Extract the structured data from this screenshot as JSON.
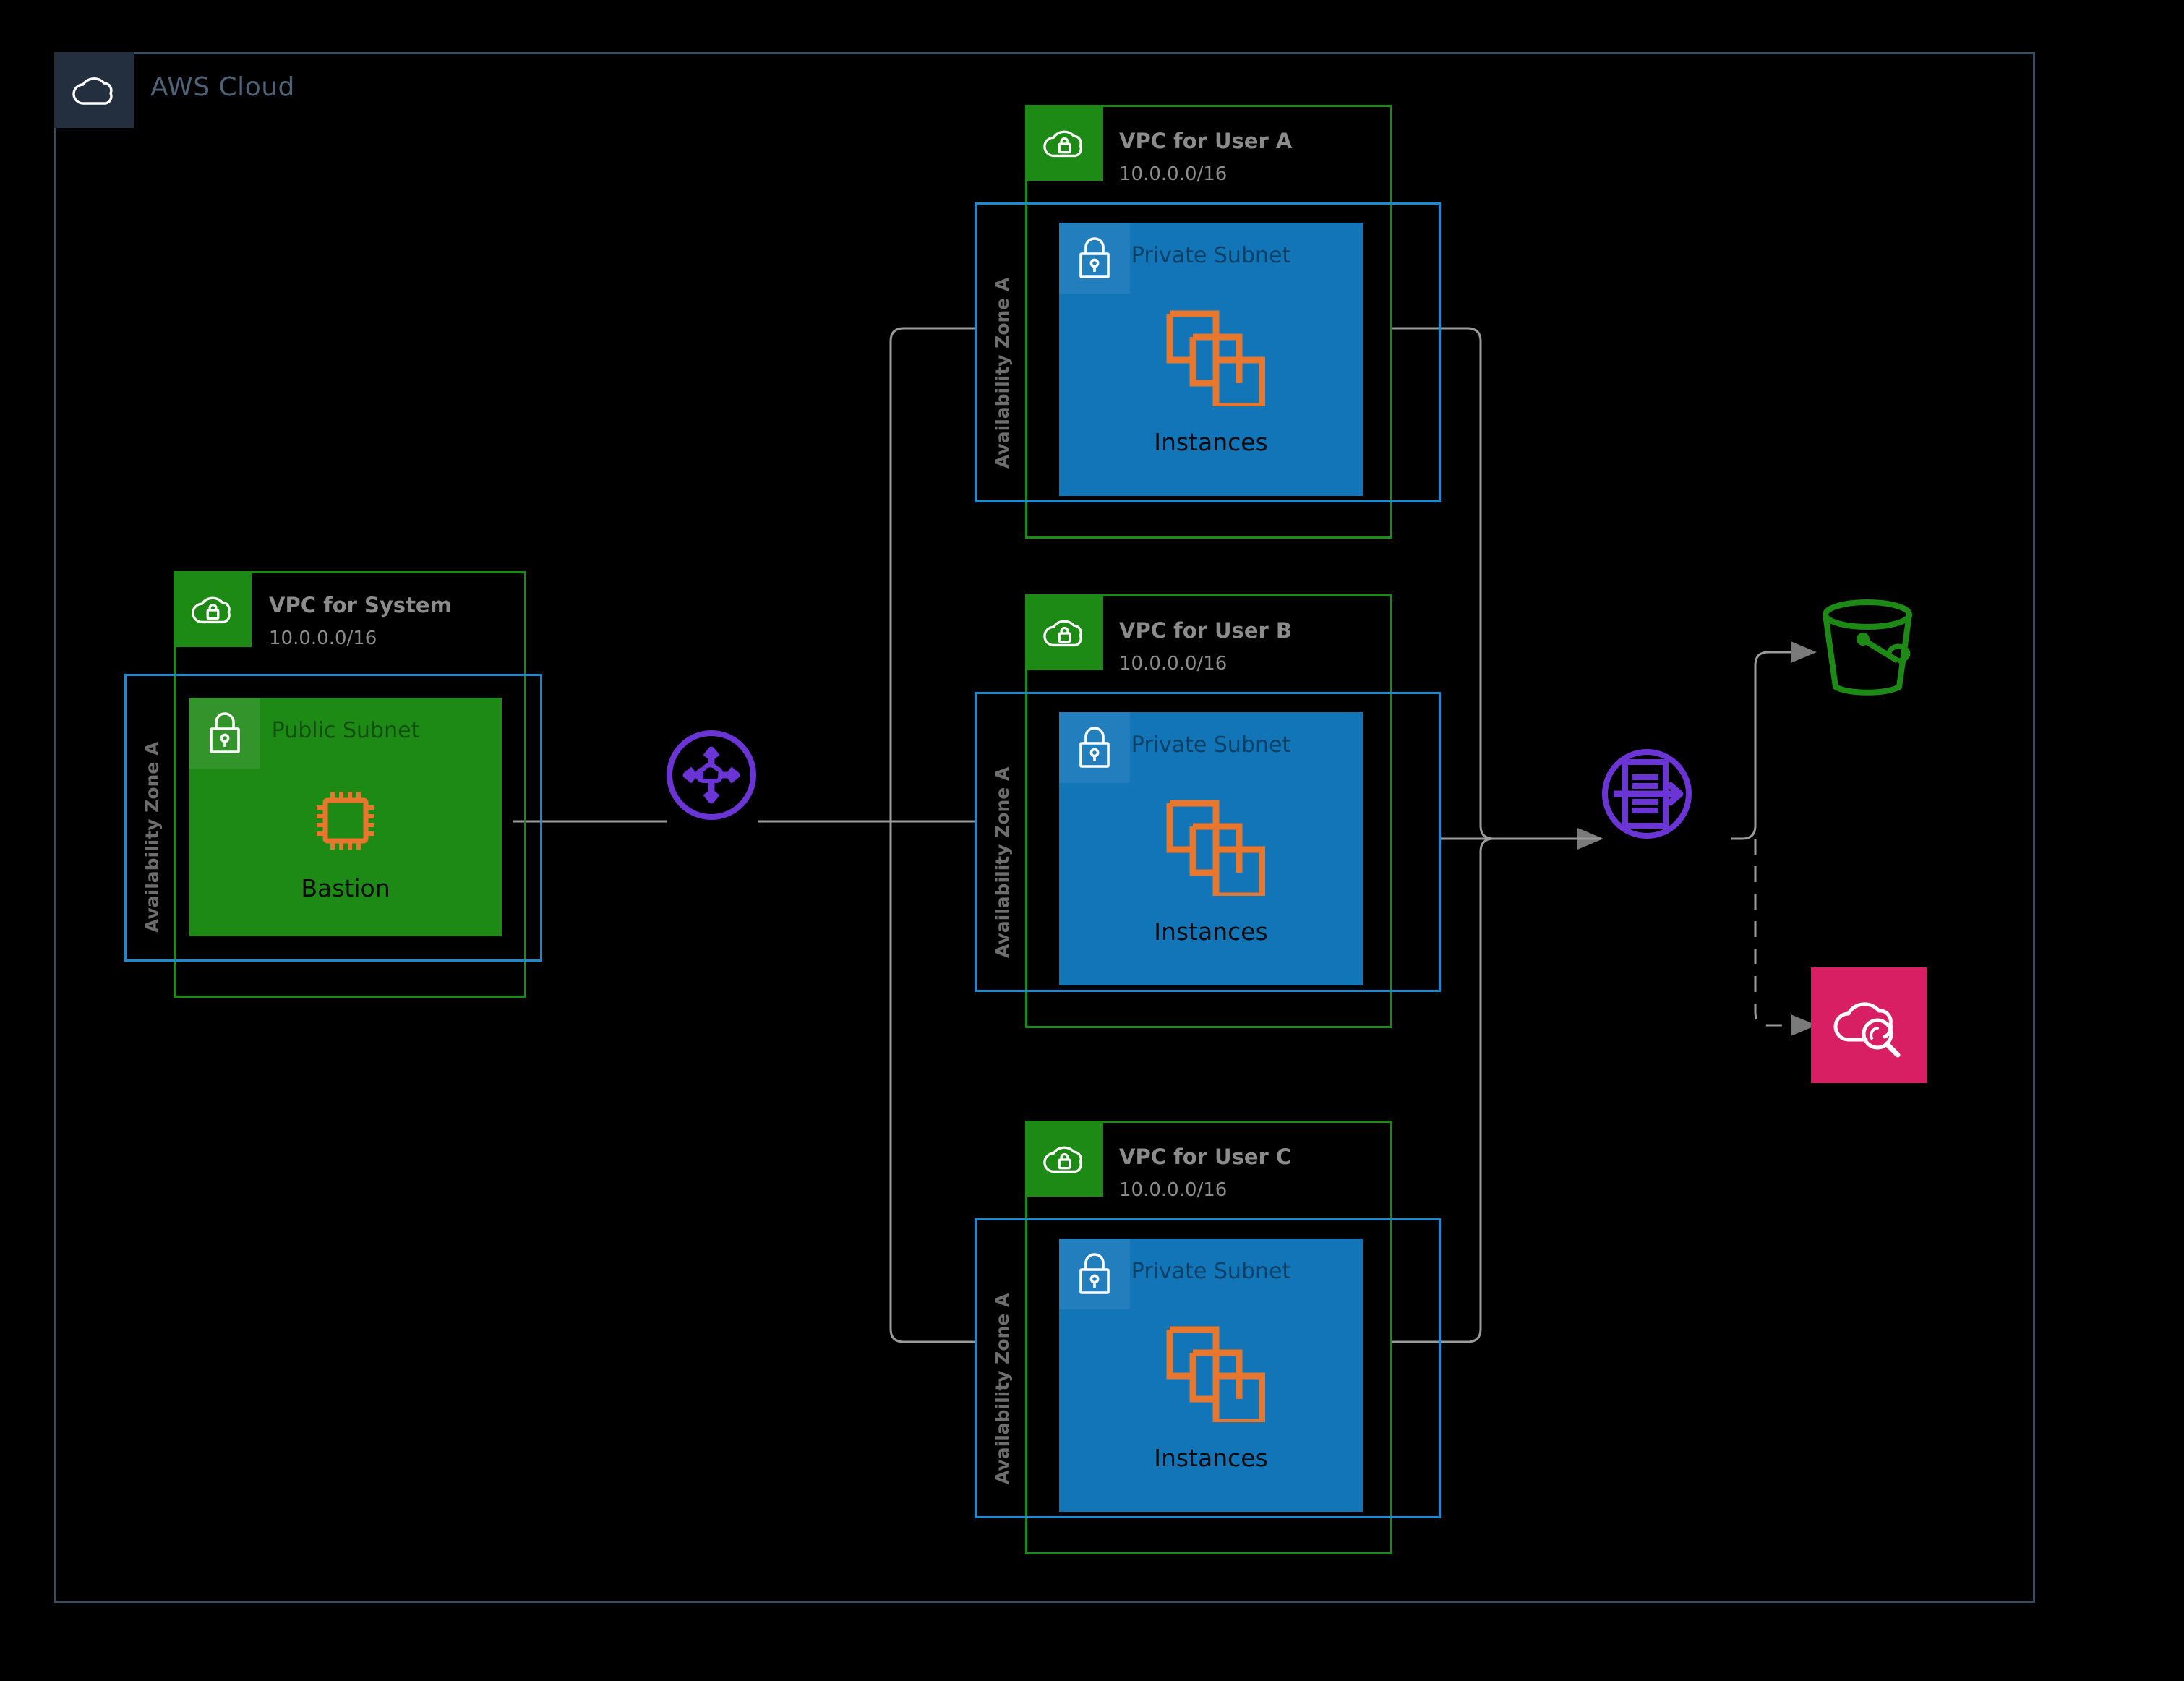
{
  "diagram": {
    "cloud": {
      "label": "AWS Cloud",
      "icon": "aws-cloud-icon",
      "frame_color": "#3B4C5E",
      "badge_color": "#232F3E",
      "label_color": "#4E6377"
    },
    "colors": {
      "vpc_green": "#1E8A16",
      "az_blue": "#1B8BD0",
      "private_subnet_blue": "#1275B8",
      "public_subnet_green": "#1E8A16",
      "instance_orange": "#E8762C",
      "transit_purple": "#6B34D4",
      "s3_green": "#1E8A16",
      "cloudwatch_pink": "#D81F64",
      "connector_gray": "#9B9B9B",
      "text_gray": "#8C8C8C"
    },
    "vpcs": [
      {
        "id": "vpc-system",
        "title": "VPC for System",
        "cidr": "10.0.0.0/16",
        "icon": "vpc-cloud-lock-icon",
        "az": {
          "label": "Availability Zone A"
        },
        "subnet": {
          "type": "public",
          "title": "Public Subnet",
          "icon": "subnet-lock-icon",
          "resource": {
            "label": "Bastion",
            "icon": "ec2-chip-icon"
          }
        }
      },
      {
        "id": "vpc-user-a",
        "title": "VPC for User A",
        "cidr": "10.0.0.0/16",
        "icon": "vpc-cloud-lock-icon",
        "az": {
          "label": "Availability Zone A"
        },
        "subnet": {
          "type": "private",
          "title": "Private Subnet",
          "icon": "subnet-lock-icon",
          "resource": {
            "label": "Instances",
            "icon": "instances-icon"
          }
        }
      },
      {
        "id": "vpc-user-b",
        "title": "VPC for User B",
        "cidr": "10.0.0.0/16",
        "icon": "vpc-cloud-lock-icon",
        "az": {
          "label": "Availability Zone A"
        },
        "subnet": {
          "type": "private",
          "title": "Private Subnet",
          "icon": "subnet-lock-icon",
          "resource": {
            "label": "Instances",
            "icon": "instances-icon"
          }
        }
      },
      {
        "id": "vpc-user-c",
        "title": "VPC for User C",
        "cidr": "10.0.0.0/16",
        "icon": "vpc-cloud-lock-icon",
        "az": {
          "label": "Availability Zone A"
        },
        "subnet": {
          "type": "private",
          "title": "Private Subnet",
          "icon": "subnet-lock-icon",
          "resource": {
            "label": "Instances",
            "icon": "instances-icon"
          }
        }
      }
    ],
    "services": [
      {
        "id": "transit-gateway",
        "icon": "transit-gateway-icon",
        "label": ""
      },
      {
        "id": "firehose",
        "icon": "kinesis-firehose-icon",
        "label": ""
      },
      {
        "id": "s3-bucket",
        "icon": "s3-bucket-icon",
        "label": ""
      },
      {
        "id": "cloudwatch",
        "icon": "cloudwatch-search-icon",
        "label": ""
      }
    ],
    "connections": [
      {
        "from": "vpc-system",
        "to": "transit-gateway",
        "style": "solid",
        "arrow": false
      },
      {
        "from": "transit-gateway",
        "to": "vpc-user-a",
        "style": "solid",
        "arrow": false
      },
      {
        "from": "transit-gateway",
        "to": "vpc-user-b",
        "style": "solid",
        "arrow": false
      },
      {
        "from": "transit-gateway",
        "to": "vpc-user-c",
        "style": "solid",
        "arrow": false
      },
      {
        "from": "vpc-user-a",
        "to": "firehose",
        "style": "solid",
        "arrow": true
      },
      {
        "from": "vpc-user-b",
        "to": "firehose",
        "style": "solid",
        "arrow": true
      },
      {
        "from": "vpc-user-c",
        "to": "firehose",
        "style": "solid",
        "arrow": true
      },
      {
        "from": "firehose",
        "to": "s3-bucket",
        "style": "solid",
        "arrow": true
      },
      {
        "from": "firehose",
        "to": "cloudwatch",
        "style": "dashed",
        "arrow": true
      }
    ]
  }
}
